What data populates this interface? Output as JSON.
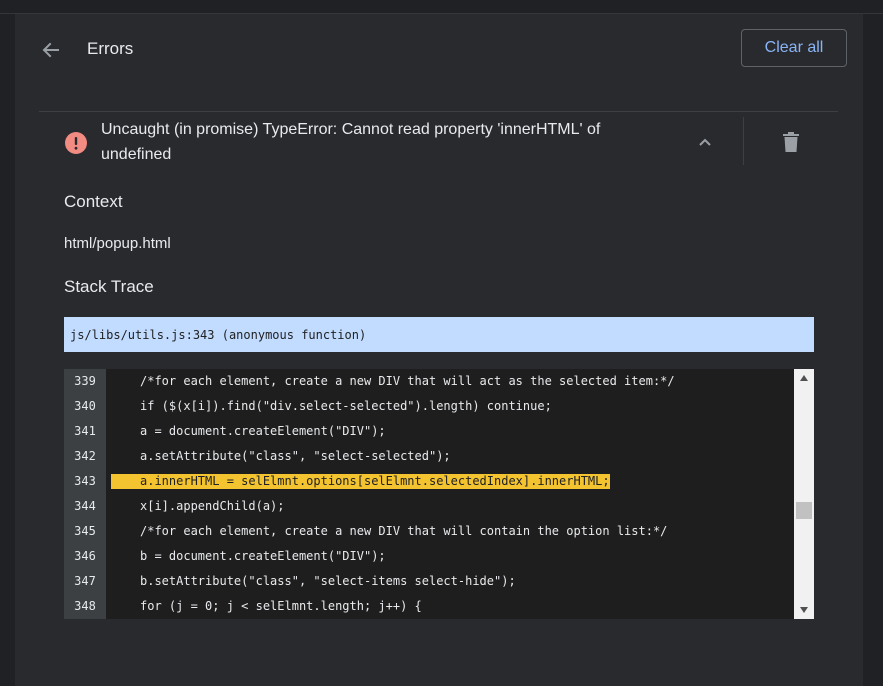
{
  "header": {
    "title": "Errors",
    "back_icon": "arrow-left-icon",
    "clear_label": "Clear all"
  },
  "error": {
    "icon": "error-circle-icon",
    "message": "Uncaught (in promise) TypeError: Cannot read property 'innerHTML' of undefined",
    "collapse_icon": "chevron-up-icon",
    "delete_icon": "trash-icon"
  },
  "context": {
    "heading": "Context",
    "value": "html/popup.html"
  },
  "stack_trace": {
    "heading": "Stack Trace",
    "frame": "js/libs/utils.js:343 (anonymous function)"
  },
  "code": {
    "highlight_line": 343,
    "lines": [
      {
        "num": "339",
        "text": "/*for each element, create a new DIV that will act as the selected item:*/"
      },
      {
        "num": "340",
        "text": "if ($(x[i]).find(\"div.select-selected\").length) continue;"
      },
      {
        "num": "341",
        "text": "a = document.createElement(\"DIV\");"
      },
      {
        "num": "342",
        "text": "a.setAttribute(\"class\", \"select-selected\");"
      },
      {
        "num": "343",
        "text": "a.innerHTML = selElmnt.options[selElmnt.selectedIndex].innerHTML;"
      },
      {
        "num": "344",
        "text": "x[i].appendChild(a);"
      },
      {
        "num": "345",
        "text": "/*for each element, create a new DIV that will contain the option list:*/"
      },
      {
        "num": "346",
        "text": "b = document.createElement(\"DIV\");"
      },
      {
        "num": "347",
        "text": "b.setAttribute(\"class\", \"select-items select-hide\");"
      },
      {
        "num": "348",
        "text": "for (j = 0; j < selElmnt.length; j++) {"
      }
    ]
  },
  "colors": {
    "background": "#202124",
    "panel": "#292a2d",
    "accent": "#8ab4f8",
    "error": "#f28b82",
    "frame_highlight": "#c2dcff",
    "line_highlight": "#f4c430"
  }
}
